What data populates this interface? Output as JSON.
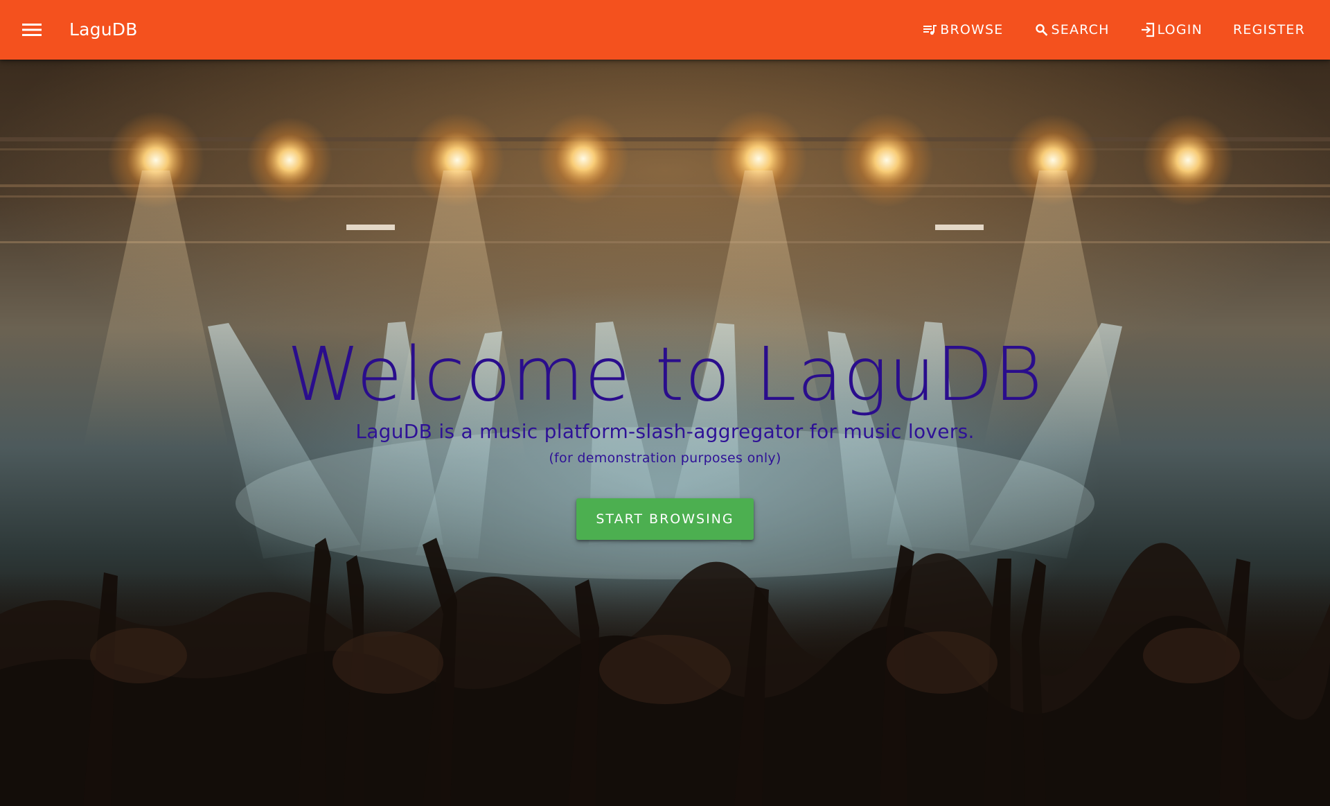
{
  "app": {
    "brand": "LaguDB",
    "accent_color": "#f4511e",
    "cta_color": "#4caf50",
    "heading_color": "#2a0d8c"
  },
  "topbar": {
    "menu_icon": "menu-icon",
    "nav": {
      "browse": {
        "label": "BROWSE",
        "icon": "playlist-music-icon"
      },
      "search": {
        "label": "SEARCH",
        "icon": "search-icon"
      },
      "login": {
        "label": "LOGIN",
        "icon": "login-icon"
      },
      "register": {
        "label": "REGISTER"
      }
    }
  },
  "hero": {
    "background": "concert-crowd-stage-lights-photo",
    "title": "Welcome to LaguDB",
    "subtitle": "LaguDB is a music platform-slash-aggregator for music lovers.",
    "note": "(for demonstration purposes only)",
    "cta_label": "START BROWSING"
  }
}
